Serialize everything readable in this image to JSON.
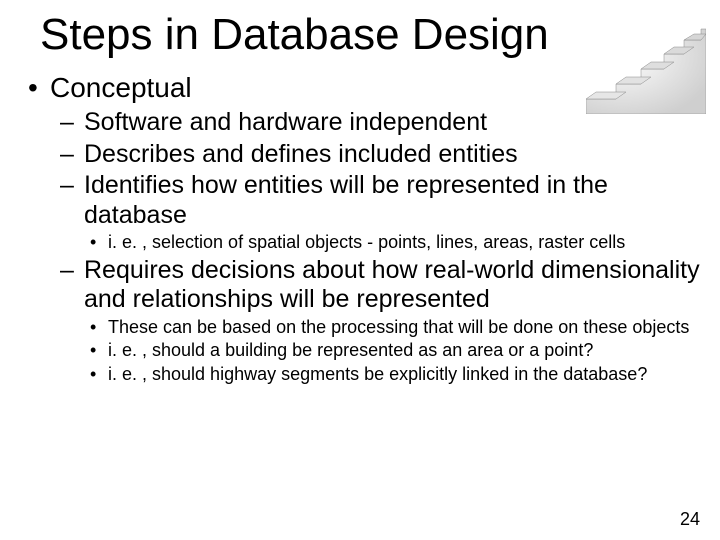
{
  "title": "Steps in Database Design",
  "page_number": "24",
  "bullets": {
    "l1_1": "Conceptual",
    "l2_1": "Software and hardware independent",
    "l2_2": "Describes and defines included entities",
    "l2_3": "Identifies how entities will be represented in the database",
    "l3_1": "i. e. , selection of spatial objects - points, lines, areas, raster cells",
    "l2_4": "Requires decisions about how real-world dimensionality and relationships will be represented",
    "l3_2": "These can be based on the processing that will be done on these objects",
    "l3_3": "i. e. , should a building be represented as an area or a point?",
    "l3_4": "i. e. , should highway segments be explicitly linked in the database?"
  }
}
